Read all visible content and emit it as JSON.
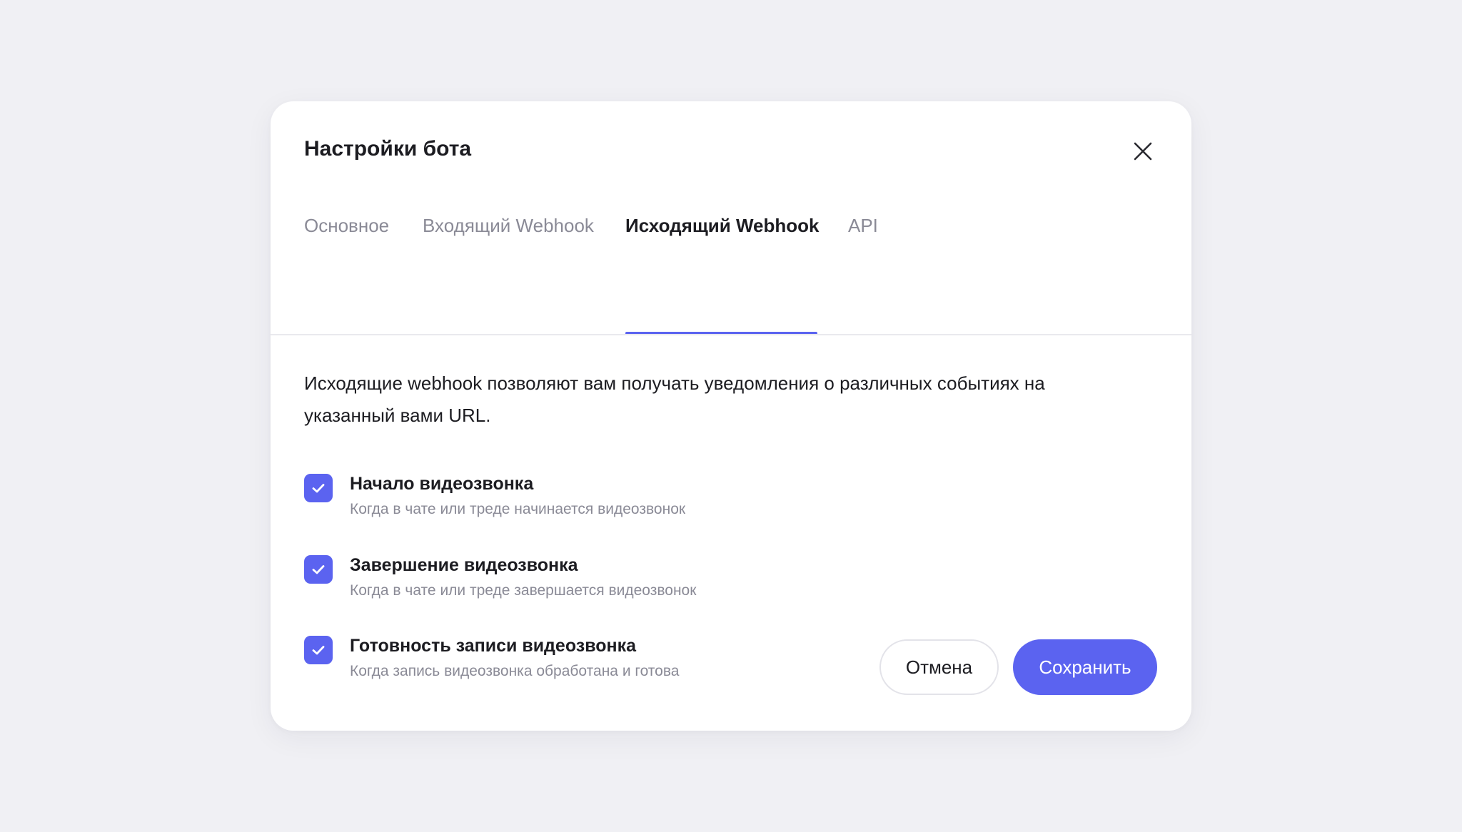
{
  "modal": {
    "title": "Настройки бота",
    "close_icon": "close-icon"
  },
  "tabs": [
    {
      "label": "Основное",
      "active": false
    },
    {
      "label": "Входящий Webhook",
      "active": false
    },
    {
      "label": "Исходящий Webhook",
      "active": true
    },
    {
      "label": "API",
      "active": false
    }
  ],
  "description_line1": "Исходящие webhook позволяют вам получать уведомления о различных событиях на",
  "description_line2": "указанный вами URL.",
  "events": [
    {
      "title": "Начало видеозвонка",
      "subtitle": "Когда в чате или треде начинается видеозвонок",
      "checked": true
    },
    {
      "title": "Завершение видеозвонка",
      "subtitle": "Когда в чате или треде завершается видеозвонок",
      "checked": true
    },
    {
      "title": "Готовность записи видеозвонка",
      "subtitle": "Когда запись видеозвонка обработана и готова",
      "checked": true
    }
  ],
  "buttons": {
    "cancel_label": "Отмена",
    "save_label": "Сохранить"
  },
  "colors": {
    "accent": "#5b63f0",
    "background": "#f0f0f4",
    "text_primary": "#1c1c21",
    "text_secondary": "#8a8a96"
  }
}
